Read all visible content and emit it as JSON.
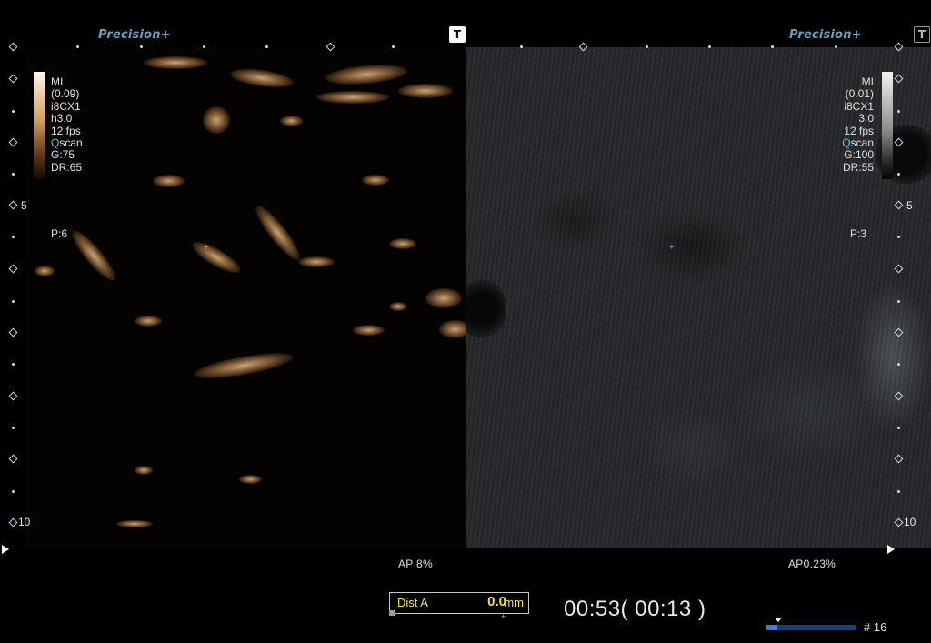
{
  "header": {
    "brand_left": "Precision+",
    "brand_right": "Precision+",
    "t_button_left": "T",
    "t_button_right": "T"
  },
  "left_pane": {
    "params": [
      "MI",
      "(0.09)",
      "i8CX1",
      "h3.0",
      "12 fps",
      "scan",
      "G:75",
      "DR:65"
    ],
    "q_prefix": "Q",
    "persist": "P:6",
    "colormap": "orange-contrast"
  },
  "right_pane": {
    "params": [
      "MI",
      "(0.01)",
      "i8CX1",
      "3.0",
      "12 fps",
      "scan",
      "G:100",
      "DR:55"
    ],
    "q_prefix": "Q",
    "persist": "P:3",
    "colormap": "grayscale"
  },
  "depth_scale": {
    "labels": [
      "5",
      "10"
    ]
  },
  "footer": {
    "ap_left": "AP  8%",
    "ap_right": "AP0.23%",
    "dist_label": "Dist A",
    "dist_value": "0.0",
    "dist_unit": "mm",
    "timer": "00:53( 00:13 )",
    "frame_number": "# 16",
    "cine_progress_fraction": 0.12
  },
  "colors": {
    "brand": "#6a9fbd",
    "measure_yellow": "#f0e24a",
    "qscan_cyan": "#57c3e6",
    "cine_bar": "#3a7fe0"
  }
}
